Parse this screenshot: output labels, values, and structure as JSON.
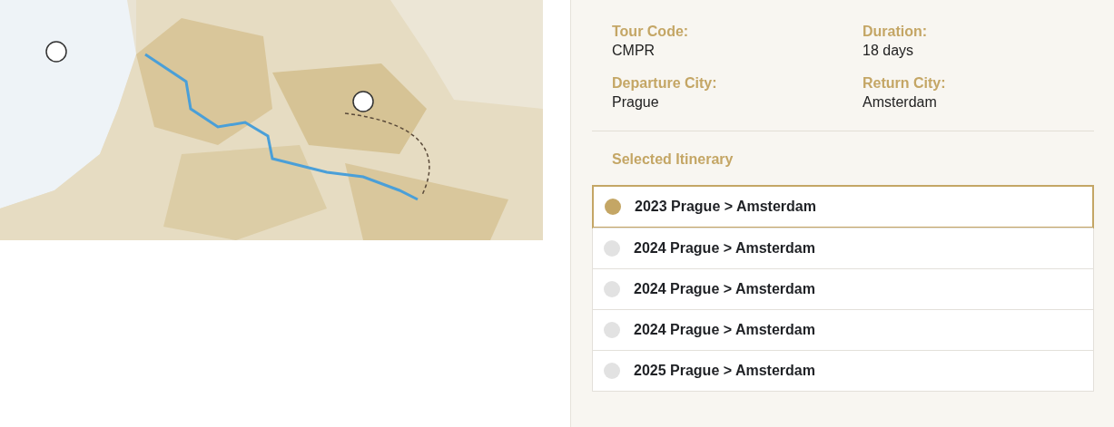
{
  "details": [
    {
      "label": "Tour Code:",
      "value": "CMPR"
    },
    {
      "label": "Duration:",
      "value": "18 days"
    },
    {
      "label": "Departure City:",
      "value": "Prague"
    },
    {
      "label": "Return City:",
      "value": "Amsterdam"
    }
  ],
  "itinerary": {
    "heading": "Selected Itinerary",
    "options": [
      {
        "label": "2023 Prague > Amsterdam",
        "selected": true
      },
      {
        "label": "2024 Prague > Amsterdam",
        "selected": false
      },
      {
        "label": "2024 Prague > Amsterdam",
        "selected": false
      },
      {
        "label": "2024 Prague > Amsterdam",
        "selected": false
      },
      {
        "label": "2025 Prague > Amsterdam",
        "selected": false
      }
    ]
  }
}
